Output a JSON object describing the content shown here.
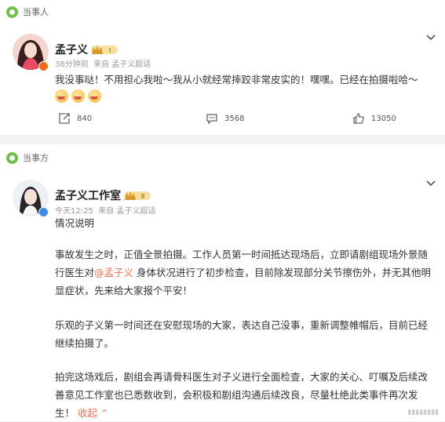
{
  "post1": {
    "topic_label": "当事人",
    "author": "孟子义",
    "level": "I",
    "time": "38分钟前",
    "source": "来自 孟子义超话",
    "content": "我没事哒！不用担心我啦～我从小就经常摔跤非常皮实的！嘿嘿。已经在拍摄啦哈～",
    "emojis": [
      "happy-emoji",
      "happy-emoji",
      "happy-emoji"
    ],
    "actions": {
      "repost": "840",
      "comment": "3568",
      "like": "13050"
    }
  },
  "post2": {
    "topic_label": "当事方",
    "author": "孟子义工作室",
    "level": "II",
    "time": "今天12:25",
    "source": "来自 孟子义超话",
    "title": "情况说明",
    "p1_before": "事故发生之时，正值全景拍摄。工作人员第一时间抵达现场后，立即请剧组现场外景随行医生对",
    "p1_mention": "@孟子义",
    "p1_after": " 身体状况进行了初步检查，目前除发现部分关节擦伤外，并无其他明显症状，先来给大家报个平安！",
    "p2": "乐观的子义第一时间还在安慰现场的大家，表达自己没事，重新调整帷帽后，目前已经继续拍摄了。",
    "p3": "拍完这场戏后，剧组会再请骨科医生对子义进行全面检查，大家的关心、叮嘱及后续改善意见工作室也已悉数收到，会积极和剧组沟通后续改良，尽量杜绝此类事件再次发生！",
    "collapse": "收起",
    "collapse_arrow": "⌃"
  }
}
